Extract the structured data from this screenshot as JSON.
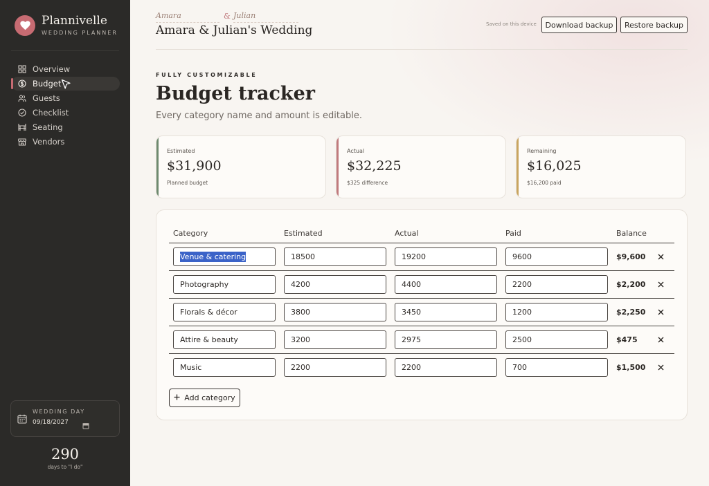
{
  "brand": {
    "name": "Plannivelle",
    "subtitle": "WEDDING PLANNER",
    "accent": "#c76b72"
  },
  "nav": [
    {
      "label": "Overview",
      "icon": "grid-icon",
      "active": false
    },
    {
      "label": "Budget",
      "icon": "dollar-icon",
      "active": true
    },
    {
      "label": "Guests",
      "icon": "people-icon",
      "active": false
    },
    {
      "label": "Checklist",
      "icon": "check-circle-icon",
      "active": false
    },
    {
      "label": "Seating",
      "icon": "table-icon",
      "active": false
    },
    {
      "label": "Vendors",
      "icon": "store-icon",
      "active": false
    }
  ],
  "wedding_day": {
    "label": "WEDDING DAY",
    "date": "09/18/2027"
  },
  "countdown": {
    "days": "290",
    "caption": "days to \"I do\""
  },
  "header": {
    "partner_a": "Amara",
    "partner_b": "Julian",
    "ampersand": "&",
    "title": "Amara & Julian's Wedding",
    "saved_note": "Saved on this device",
    "download_label": "Download backup",
    "restore_label": "Restore backup"
  },
  "page": {
    "eyebrow": "FULLY CUSTOMIZABLE",
    "title": "Budget tracker",
    "subtitle": "Every category name and amount is editable."
  },
  "stats": [
    {
      "label": "Estimated",
      "value": "$31,900",
      "note": "Planned budget",
      "color": "#6e8a6f"
    },
    {
      "label": "Actual",
      "value": "$32,225",
      "note": "$325 difference",
      "color": "#c07a7d"
    },
    {
      "label": "Remaining",
      "value": "$16,025",
      "note": "$16,200 paid",
      "color": "#c9a55f"
    }
  ],
  "table": {
    "columns": [
      "Category",
      "Estimated",
      "Actual",
      "Paid",
      "Balance"
    ],
    "rows": [
      {
        "category": "Venue & catering",
        "estimated": "18500",
        "actual": "19200",
        "paid": "9600",
        "balance": "$9,600"
      },
      {
        "category": "Photography",
        "estimated": "4200",
        "actual": "4400",
        "paid": "2200",
        "balance": "$2,200"
      },
      {
        "category": "Florals & décor",
        "estimated": "3800",
        "actual": "3450",
        "paid": "1200",
        "balance": "$2,250"
      },
      {
        "category": "Attire & beauty",
        "estimated": "3200",
        "actual": "2975",
        "paid": "2500",
        "balance": "$475"
      },
      {
        "category": "Music",
        "estimated": "2200",
        "actual": "2200",
        "paid": "700",
        "balance": "$1,500"
      }
    ],
    "add_label": "Add category"
  }
}
